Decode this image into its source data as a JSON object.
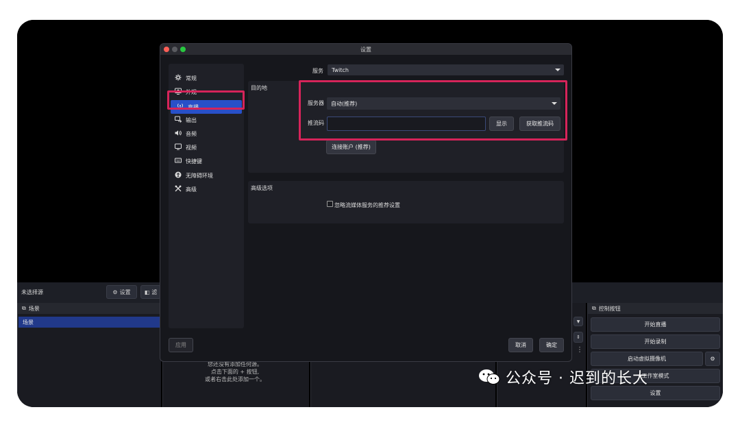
{
  "app": {
    "source_label": "未选择源",
    "settings_btn": "设置",
    "filter_btn": "滤",
    "scenes_title": "场景",
    "scene_item": "场景",
    "empty_hint_l1": "您还没有添加任何源。",
    "empty_hint_l2": "点击下面的 + 按钮,",
    "empty_hint_l3": "或者右击此处添加一个。",
    "controls_title": "控制按钮",
    "controls": [
      "开始直播",
      "开始录制",
      "启动虚拟摄像机",
      "工作室模式",
      "设置"
    ]
  },
  "watermark": "公众号 · 迟到的长大",
  "dialog": {
    "title": "设置",
    "sidebar": [
      {
        "label": "常规",
        "icon": "gear-icon"
      },
      {
        "label": "外观",
        "icon": "appearance-icon"
      },
      {
        "label": "直播",
        "icon": "antenna-icon",
        "active": true
      },
      {
        "label": "输出",
        "icon": "output-icon"
      },
      {
        "label": "音频",
        "icon": "speaker-icon"
      },
      {
        "label": "视频",
        "icon": "monitor-icon"
      },
      {
        "label": "快捷键",
        "icon": "keyboard-icon"
      },
      {
        "label": "无障碍环境",
        "icon": "accessibility-icon"
      },
      {
        "label": "高级",
        "icon": "tools-icon"
      }
    ],
    "service_label": "服务",
    "service_value": "Twitch",
    "destination_title": "目的地",
    "server_label": "服务器",
    "server_value": "自动(推荐)",
    "stream_key_label": "推流码",
    "stream_key_value": "",
    "show_btn": "显示",
    "get_key_btn": "获取推流码",
    "connect_btn": "连接账户 (推荐)",
    "advanced_title": "高级选项",
    "ignore_checkbox": "忽略流媒体服务的推荐设置",
    "apply_btn": "应用",
    "cancel_btn": "取消",
    "ok_btn": "确定"
  },
  "colors": {
    "highlight": "#d6245a",
    "active": "#2850c8",
    "scene_selected": "#21398a"
  }
}
